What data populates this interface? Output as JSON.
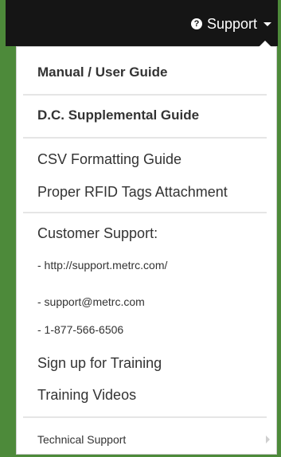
{
  "navbar": {
    "support_label": "Support",
    "help_icon": "question-circle-icon",
    "caret_icon": "caret-down-icon"
  },
  "menu": {
    "manual": "Manual / User Guide",
    "dc_guide": "D.C. Supplemental Guide",
    "csv_guide": "CSV Formatting Guide",
    "rfid_guide": "Proper RFID Tags Attachment",
    "customer_support_heading": "Customer Support:",
    "support_url": "- http://support.metrc.com/",
    "support_email": "- support@metrc.com",
    "support_phone": "- 1-877-566-6506",
    "training_signup": "Sign up for Training",
    "training_videos": "Training Videos",
    "technical_support": "Technical Support",
    "submenu_icon": "chevron-right-icon"
  },
  "colors": {
    "frame_green": "#4d8a3a",
    "navbar": "#151515",
    "menu_bg": "#ffffff",
    "text": "#333333"
  }
}
